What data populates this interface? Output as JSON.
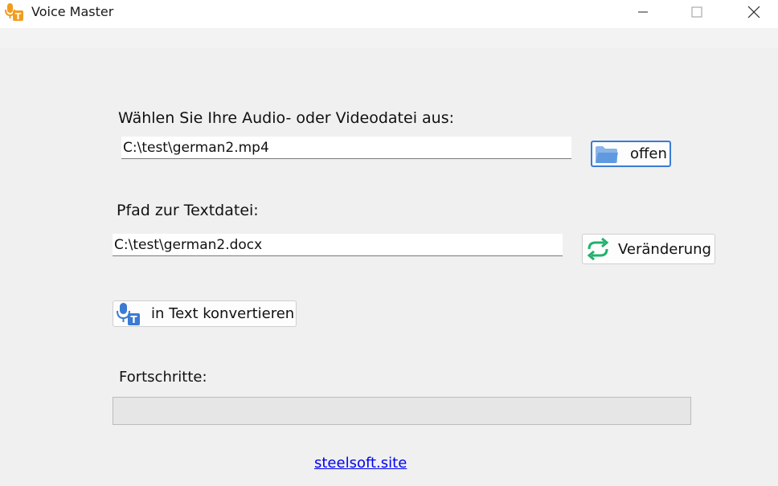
{
  "window": {
    "title": "Voice Master",
    "icon": "app-logo-icon"
  },
  "media": {
    "label": "Wählen Sie Ihre Audio- oder Videodatei aus:",
    "path": "C:\\test\\german2.mp4",
    "open_button": "offen",
    "open_icon": "folder-icon"
  },
  "text_file": {
    "label": "Pfad zur Textdatei:",
    "path": "C:\\test\\german2.docx",
    "change_button": "Veränderung",
    "change_icon": "refresh-icon"
  },
  "convert": {
    "button": "in Text konvertieren",
    "icon": "mic-text-icon"
  },
  "progress": {
    "label": "Fortschritte:",
    "value": 0
  },
  "footer": {
    "link": "steelsoft.site"
  },
  "colors": {
    "accent": "#3b7bd3",
    "link": "#0000ee",
    "refresh": "#1fb36b",
    "logo": "#f29c1f"
  }
}
